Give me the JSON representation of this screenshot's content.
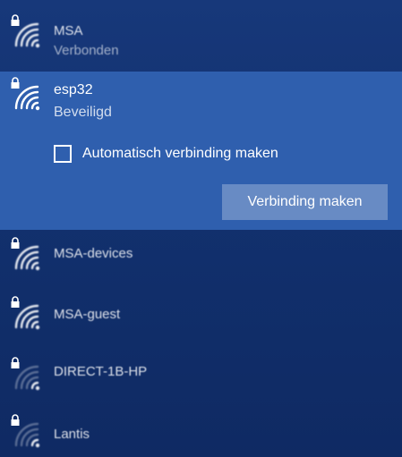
{
  "networks": [
    {
      "name": "MSA",
      "status": "Verbonden",
      "secured": true,
      "signal": "full"
    },
    {
      "name": "esp32",
      "status": "Beveiligd",
      "secured": true,
      "signal": "full",
      "selected": true
    },
    {
      "name": "MSA-devices",
      "secured": true,
      "signal": "full"
    },
    {
      "name": "MSA-guest",
      "secured": true,
      "signal": "full"
    },
    {
      "name": "DIRECT-1B-HP",
      "secured": true,
      "signal": "low"
    },
    {
      "name": "Lantis",
      "secured": true,
      "signal": "low"
    }
  ],
  "selected_panel": {
    "auto_connect_label": "Automatisch verbinding maken",
    "auto_connect_checked": false,
    "connect_button_label": "Verbinding maken"
  },
  "icons": {
    "wifi": "wifi-signal-icon",
    "lock": "lock-icon",
    "checkbox": "checkbox-icon"
  },
  "colors": {
    "panel_background": "#12316f",
    "selected_background": "#2f5fae",
    "button_background": "#6f8fc6",
    "text": "#ffffff"
  }
}
